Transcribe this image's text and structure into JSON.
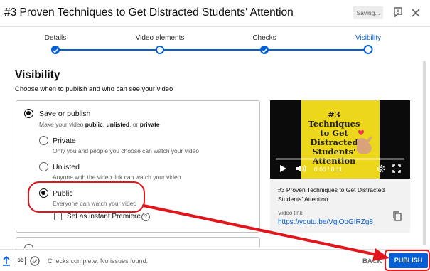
{
  "header": {
    "title": "#3 Proven Techniques to Get Distracted Students' Attention",
    "saving_label": "Saving...",
    "icons": [
      "feedback-flag-icon",
      "close-icon"
    ]
  },
  "stepper": {
    "steps": [
      {
        "label": "Details",
        "state": "done"
      },
      {
        "label": "Video elements",
        "state": "open"
      },
      {
        "label": "Checks",
        "state": "done"
      },
      {
        "label": "Visibility",
        "state": "current"
      }
    ]
  },
  "visibility": {
    "title": "Visibility",
    "subtitle": "Choose when to publish and who can see your video",
    "save_or_publish": {
      "label": "Save or publish",
      "desc_prefix": "Make your video ",
      "desc_public": "public",
      "desc_sep1": ", ",
      "desc_unlisted": "unlisted",
      "desc_sep2": ", or ",
      "desc_private": "private"
    },
    "options": [
      {
        "label": "Private",
        "desc": "Only you and people you choose can watch your video",
        "selected": false
      },
      {
        "label": "Unlisted",
        "desc": "Anyone with the video link can watch your video",
        "selected": false
      },
      {
        "label": "Public",
        "desc": "Everyone can watch your video",
        "selected": true
      }
    ],
    "premiere_label": "Set as instant Premiere",
    "help_glyph": "?"
  },
  "video": {
    "thumbnail_text": "#3 Techniques to Get Distracted Students' Attention",
    "time": "0:00 / 0:11",
    "progress": 0,
    "title": "#3 Proven Techniques to Get Distracted Students' Attention",
    "link_label": "Video link",
    "link_url": "https://youtu.be/VglOoGIRZg8"
  },
  "footer": {
    "sd_label": "SD",
    "status": "Checks complete. No issues found.",
    "back_label": "BACK",
    "publish_label": "PUBLISH"
  },
  "colors": {
    "accent": "#065fd4",
    "annotation_red": "#e1161c",
    "thumbnail_yellow": "#ecd71a"
  }
}
